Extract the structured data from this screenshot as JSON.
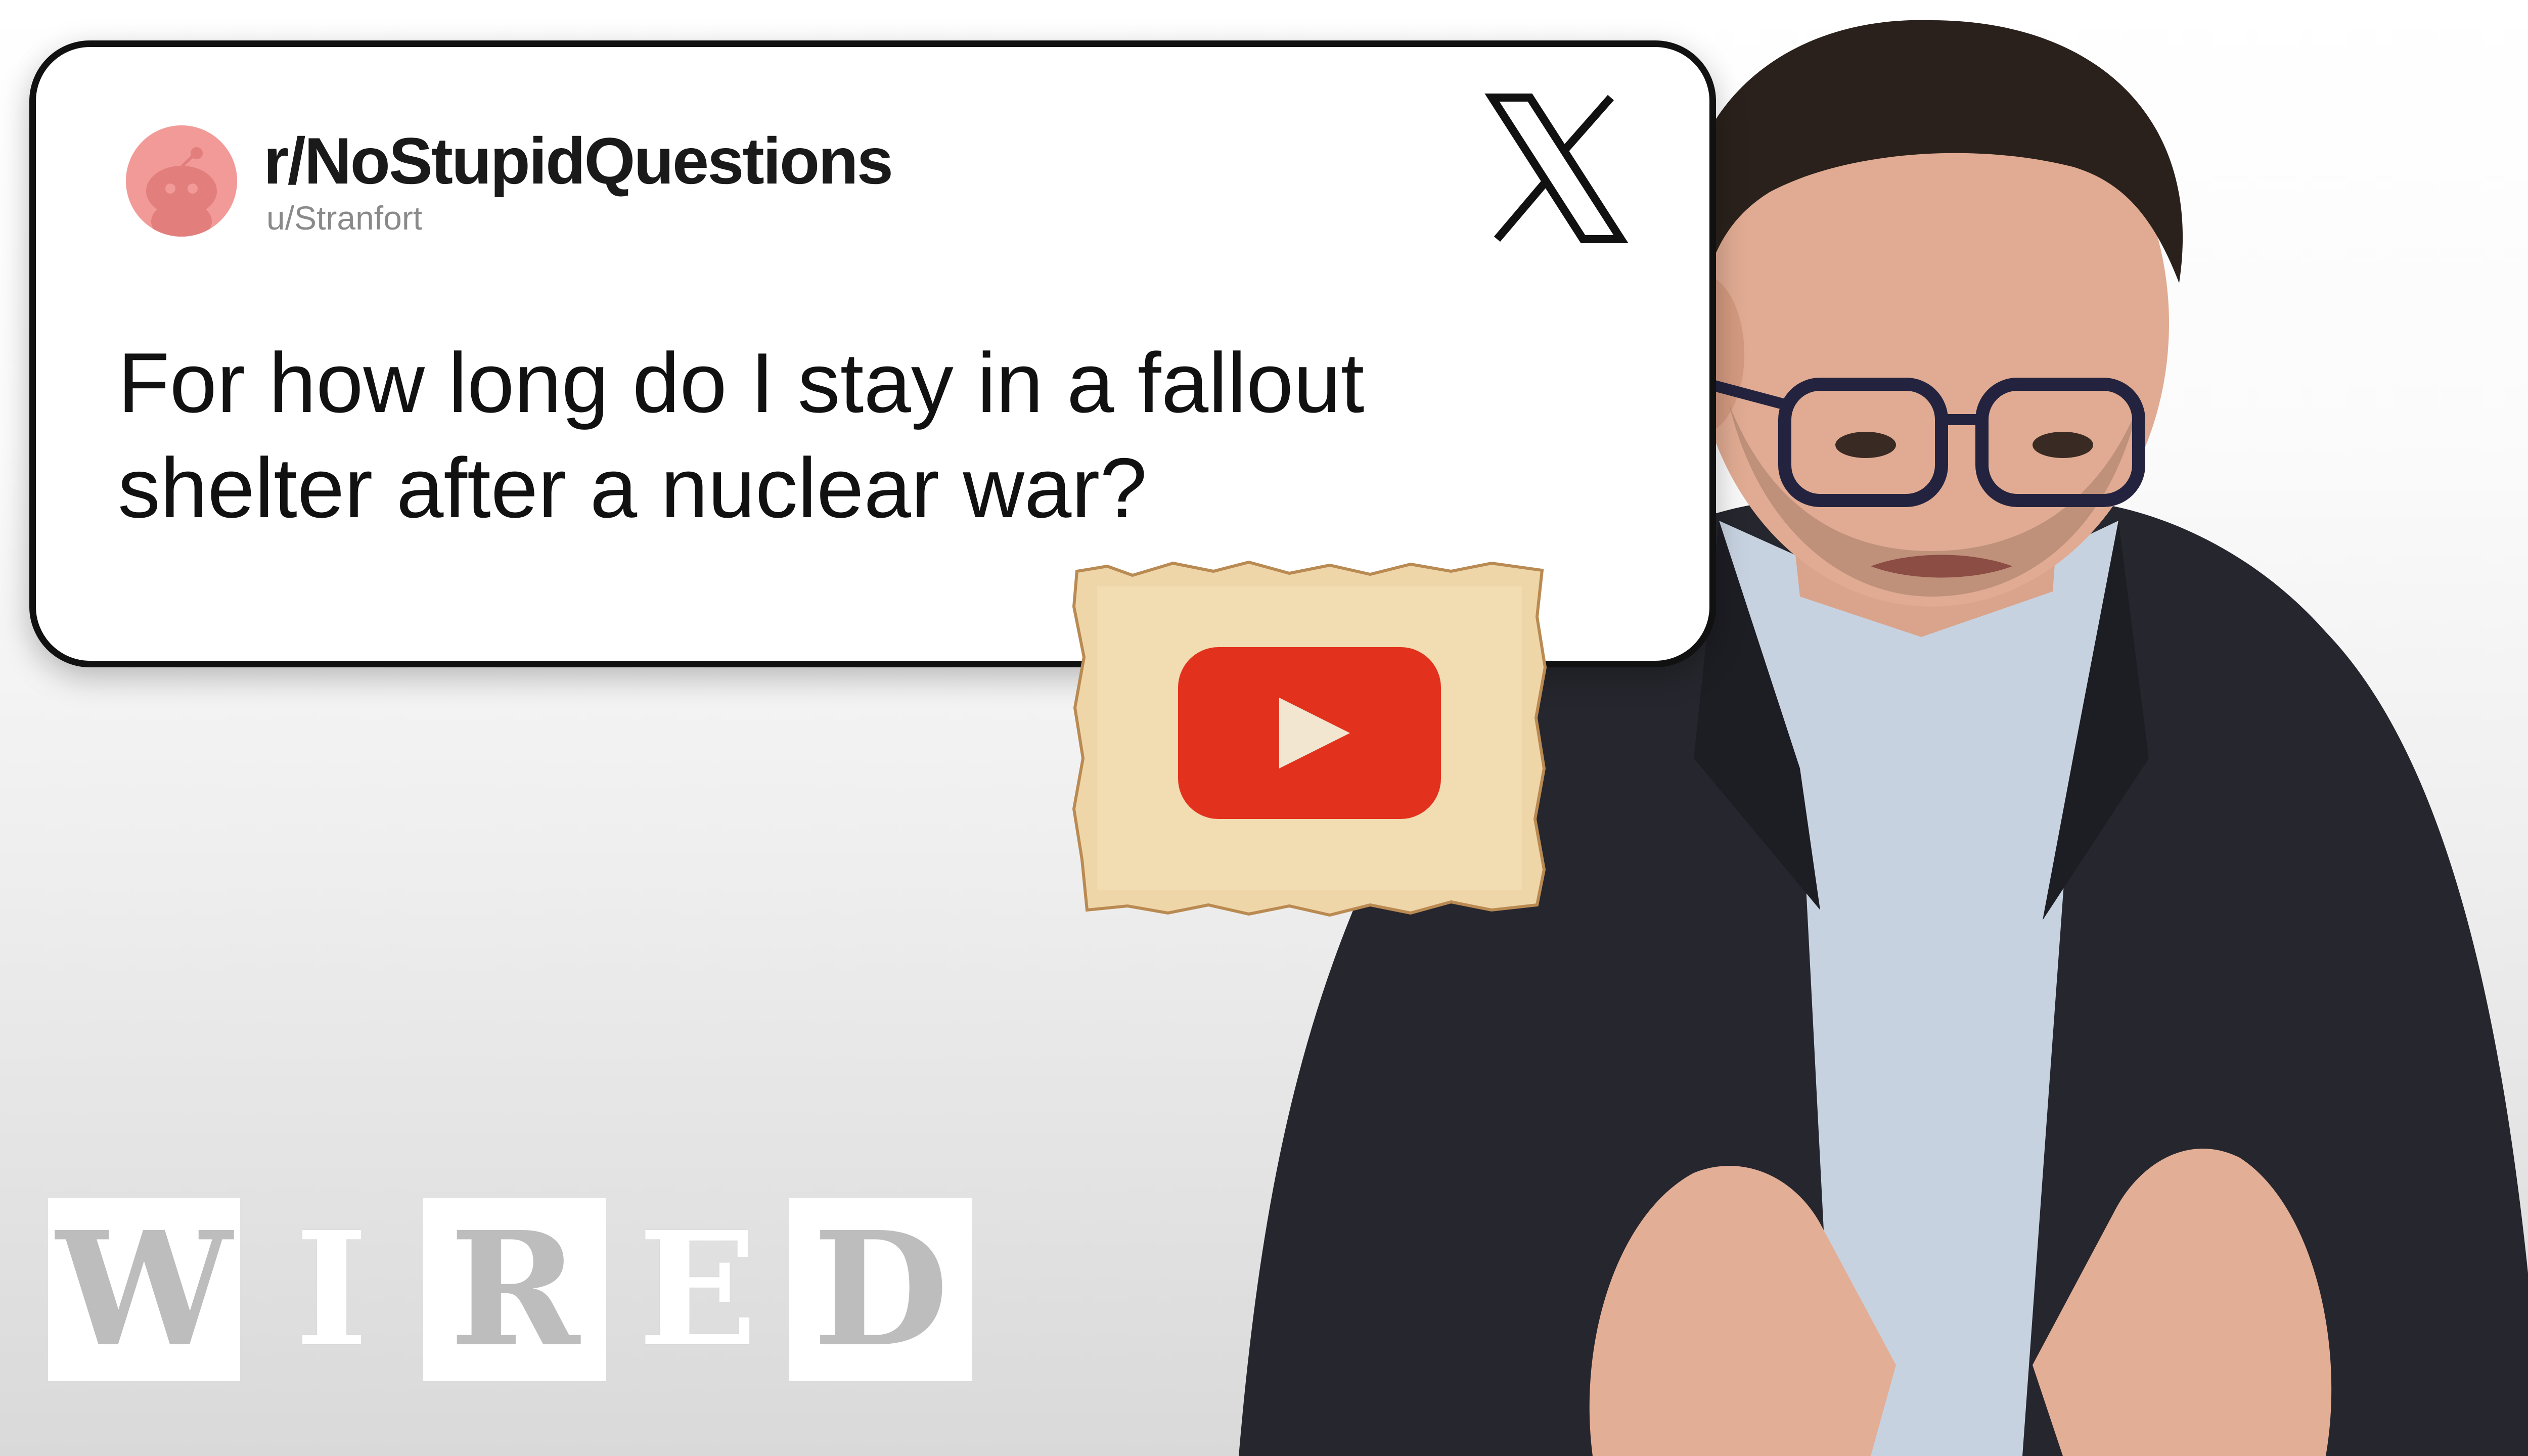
{
  "card": {
    "subreddit": "r/NoStupidQuestions",
    "username": "u/Stranfort",
    "question": "For how long do I stay in a fallout shelter after a nuclear war?",
    "avatar_icon": "reddit-snoo-icon",
    "platform_icon": "x-logo-icon"
  },
  "overlay": {
    "icon": "youtube-play-icon",
    "background": "parchment"
  },
  "logo": {
    "letters": [
      "W",
      "I",
      "R",
      "E",
      "D"
    ]
  },
  "colors": {
    "card_border": "#111111",
    "avatar": "#f19a98",
    "youtube_red": "#e2321d",
    "parchment": "#efd6a8"
  }
}
